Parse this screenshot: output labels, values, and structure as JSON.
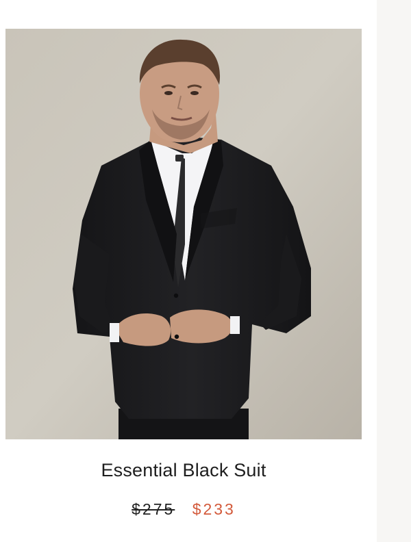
{
  "product": {
    "image_alt": "Man wearing Essential Black Suit",
    "title": "Essential Black Suit",
    "price_original": "$275",
    "price_sale": "$233"
  },
  "colors": {
    "background": "#ffffff",
    "gutter": "#f7f6f4",
    "title_text": "#1e1e1e",
    "sale_price": "#d35a3b",
    "suit": "#1b1b1d"
  }
}
